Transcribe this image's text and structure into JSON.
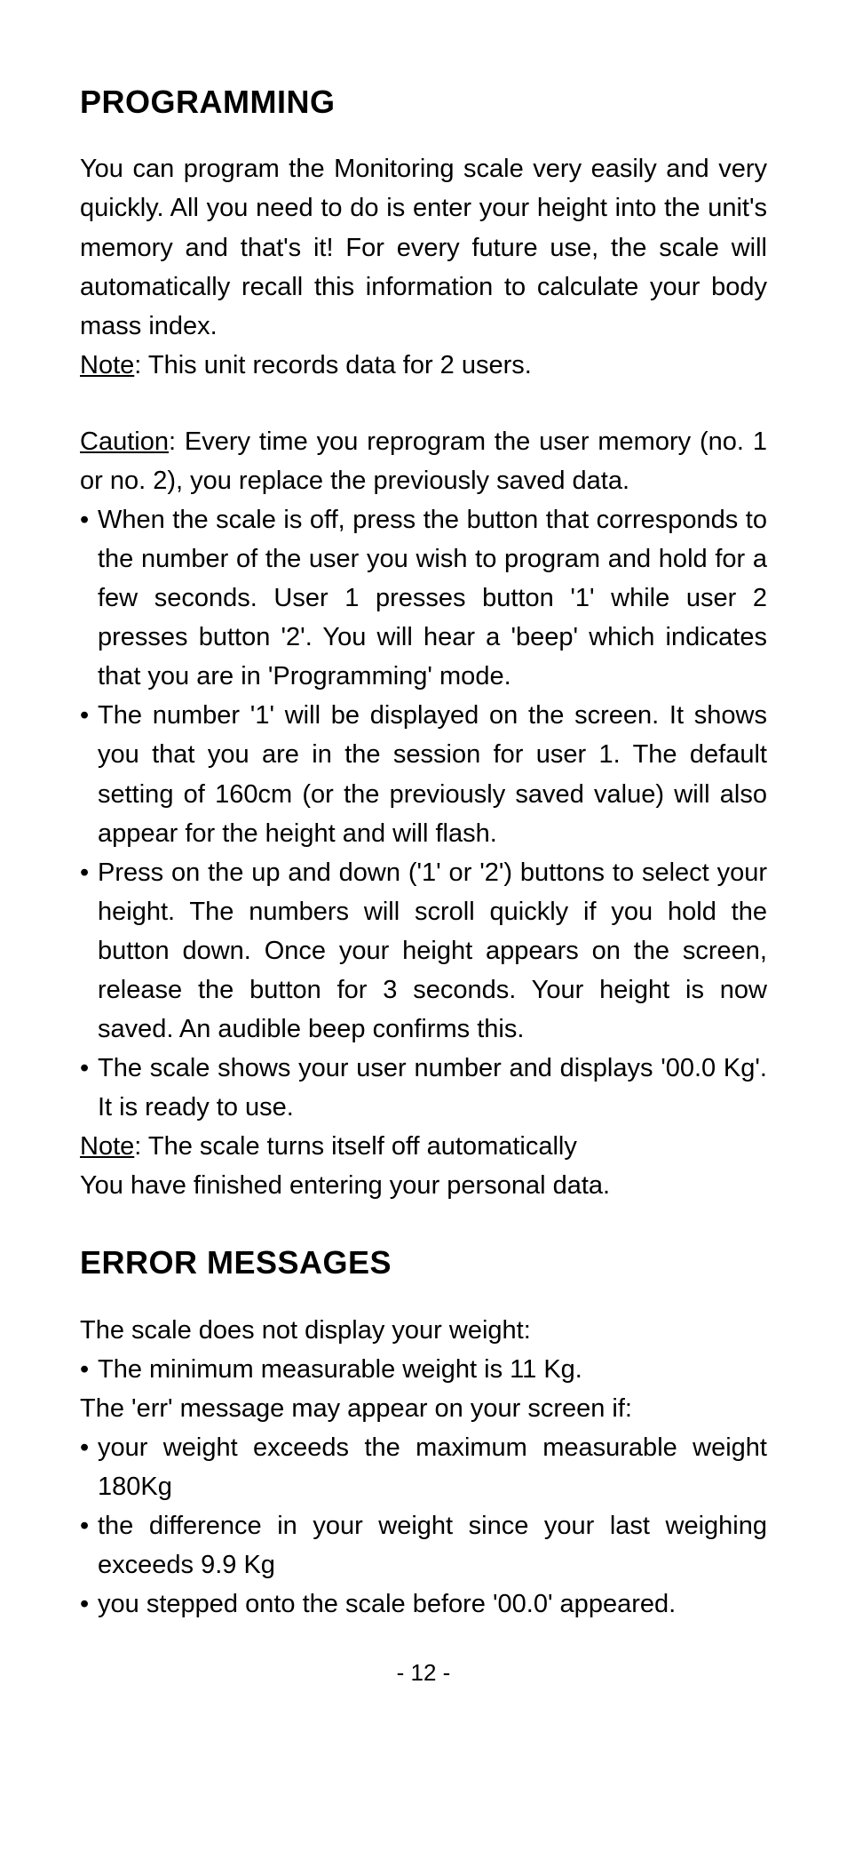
{
  "programming": {
    "heading": "PROGRAMMING",
    "intro": "You can program the Monitoring scale very easily and very quickly. All you need to do is enter your height into the unit's memory and that's it! For every future use, the scale will automatically recall this information to calculate your body mass index.",
    "note1_label": "Note",
    "note1_text": ": This unit records data for 2 users.",
    "caution_label": "Caution",
    "caution_text": ": Every time you reprogram the user memory (no. 1 or no. 2), you replace the previously saved data.",
    "steps": [
      "When the scale is off, press the button that corresponds to the number of the user you wish to program and hold for a few seconds. User 1 presses button '1' while user 2 presses button '2'. You will hear a 'beep' which indicates that you are in 'Programming' mode.",
      "The number '1' will be displayed on the screen. It shows you that you are in the session for user 1. The default setting of 160cm (or the previously saved value) will also appear for the height and will flash.",
      "Press on the up and down ('1' or '2') buttons to select your height. The numbers will scroll quickly if you hold the button down. Once your height appears on the screen, release the button for 3 seconds. Your height is now saved. An audible beep confirms this.",
      "The scale shows your user number and displays '00.0 Kg'. It is ready to use."
    ],
    "note2_label": "Note",
    "note2_text": ": The scale turns itself off automatically",
    "closing": "You have finished entering your personal data."
  },
  "errors": {
    "heading": "ERROR MESSAGES",
    "no_weight_intro": "The scale does not display your weight:",
    "no_weight_items": [
      "The minimum measurable weight is 11 Kg."
    ],
    "err_intro": "The 'err' message may appear on your screen if:",
    "err_items": [
      "your weight exceeds the maximum measurable weight 180Kg",
      "the difference in your weight since your last weighing exceeds 9.9 Kg",
      "you stepped onto the scale before '00.0' appeared."
    ]
  },
  "page_number": "- 12 -"
}
